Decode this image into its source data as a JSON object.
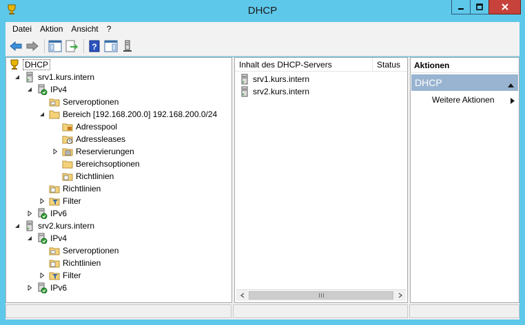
{
  "window": {
    "title": "DHCP"
  },
  "menu": [
    "Datei",
    "Aktion",
    "Ansicht",
    "?"
  ],
  "tree": {
    "root": "DHCP",
    "srv1": "srv1.kurs.intern",
    "srv1_ipv4": "IPv4",
    "srv1_serveroptionen": "Serveroptionen",
    "srv1_bereich": "Bereich [192.168.200.0] 192.168.200.0/24",
    "adresspool": "Adresspool",
    "adressleases": "Adressleases",
    "reservierungen": "Reservierungen",
    "bereichsoptionen": "Bereichsoptionen",
    "bereich_richtlinien": "Richtlinien",
    "srv1_richtlinien": "Richtlinien",
    "srv1_filter": "Filter",
    "srv1_ipv6": "IPv6",
    "srv2": "srv2.kurs.intern",
    "srv2_ipv4": "IPv4",
    "srv2_serveroptionen": "Serveroptionen",
    "srv2_richtlinien": "Richtlinien",
    "srv2_filter": "Filter",
    "srv2_ipv6": "IPv6"
  },
  "list": {
    "columns": [
      "Inhalt des DHCP-Servers",
      "Status"
    ],
    "rows": [
      "srv1.kurs.intern",
      "srv2.kurs.intern"
    ]
  },
  "actions": {
    "header": "Aktionen",
    "section": "DHCP",
    "item": "Weitere Aktionen"
  },
  "colors": {
    "titlebar": "#5ec8ea",
    "close_button": "#c7423a",
    "actions_section": "#99b4d1"
  },
  "icons": [
    "dhcp-icon",
    "server-icon",
    "ipv4-icon",
    "folder-icon",
    "filter-icon",
    "back-arrow-icon",
    "forward-arrow-icon",
    "help-icon"
  ]
}
